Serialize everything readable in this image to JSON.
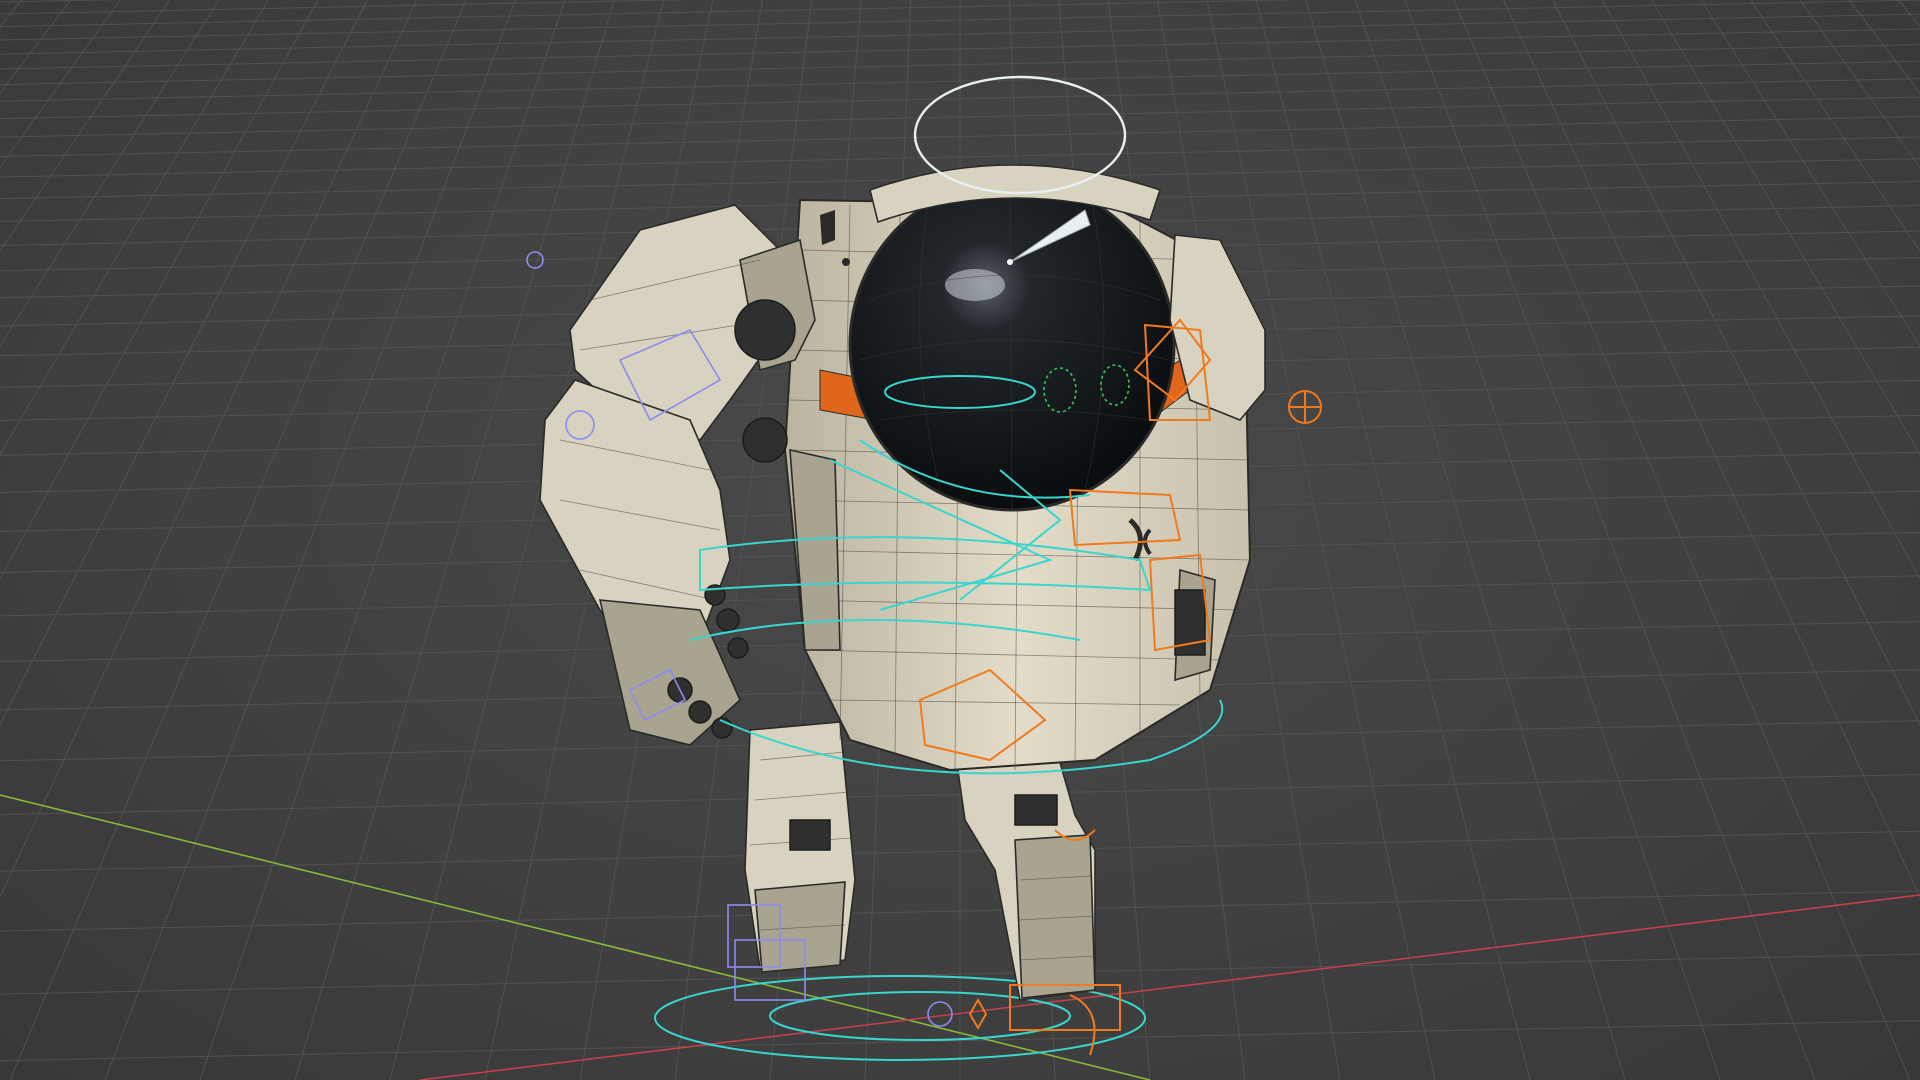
{
  "viewport": {
    "background_color": "#404040",
    "grid_color": "#525252",
    "x_axis_color": "#c0404c",
    "y_axis_color": "#8ab83c"
  },
  "scene": {
    "object": "robot-character-mesh",
    "body_color": "#d8d2c0",
    "visor_color": "#101418",
    "stripe_color": "#e0661c",
    "rig_colors": {
      "cyan_controls": "#38d6cc",
      "orange_controls": "#f07a1e",
      "blue_controls": "#8c8cf0",
      "head_control": "#e8f0f0"
    }
  }
}
